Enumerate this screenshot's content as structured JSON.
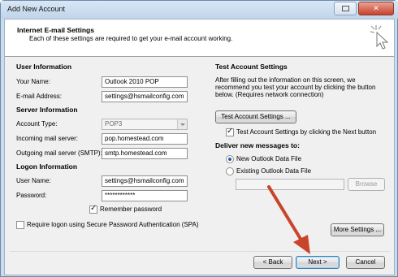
{
  "window": {
    "title": "Add New Account"
  },
  "header": {
    "title": "Internet E-mail Settings",
    "subtitle": "Each of these settings are required to get your e-mail account working."
  },
  "user_info": {
    "heading": "User Information",
    "name_label": "Your Name:",
    "name_value": "Outlook 2010 POP",
    "email_label": "E-mail Address:",
    "email_value": "settings@hsmailconfig.com"
  },
  "server_info": {
    "heading": "Server Information",
    "account_type_label": "Account Type:",
    "account_type_value": "POP3",
    "incoming_label": "Incoming mail server:",
    "incoming_value": "pop.homestead.com",
    "outgoing_label": "Outgoing mail server (SMTP):",
    "outgoing_value": "smtp.homestead.com"
  },
  "logon_info": {
    "heading": "Logon Information",
    "username_label": "User Name:",
    "username_value": "settings@hsmailconfig.com",
    "password_label": "Password:",
    "password_value": "************",
    "remember_label": "Remember password",
    "remember_checked": true,
    "spa_label": "Require logon using Secure Password Authentication (SPA)",
    "spa_checked": false
  },
  "test_settings": {
    "heading": "Test Account Settings",
    "description_line1": "After filling out the information on this screen, we",
    "description_line2": "recommend you test your account by clicking the button",
    "description_line3": "below. (Requires network connection)",
    "test_button": "Test Account Settings ...",
    "test_next_label": "Test Account Settings by clicking the Next button",
    "test_next_checked": true
  },
  "delivery": {
    "heading": "Deliver new messages to:",
    "option_new": "New Outlook Data File",
    "option_existing": "Existing Outlook Data File",
    "selected": "new",
    "existing_path": "",
    "browse_button": "Browse"
  },
  "buttons": {
    "more_settings": "More Settings ...",
    "back": "< Back",
    "next": "Next >",
    "cancel": "Cancel"
  },
  "colors": {
    "arrow": "#c8452c",
    "frame": "#c9dcef"
  }
}
